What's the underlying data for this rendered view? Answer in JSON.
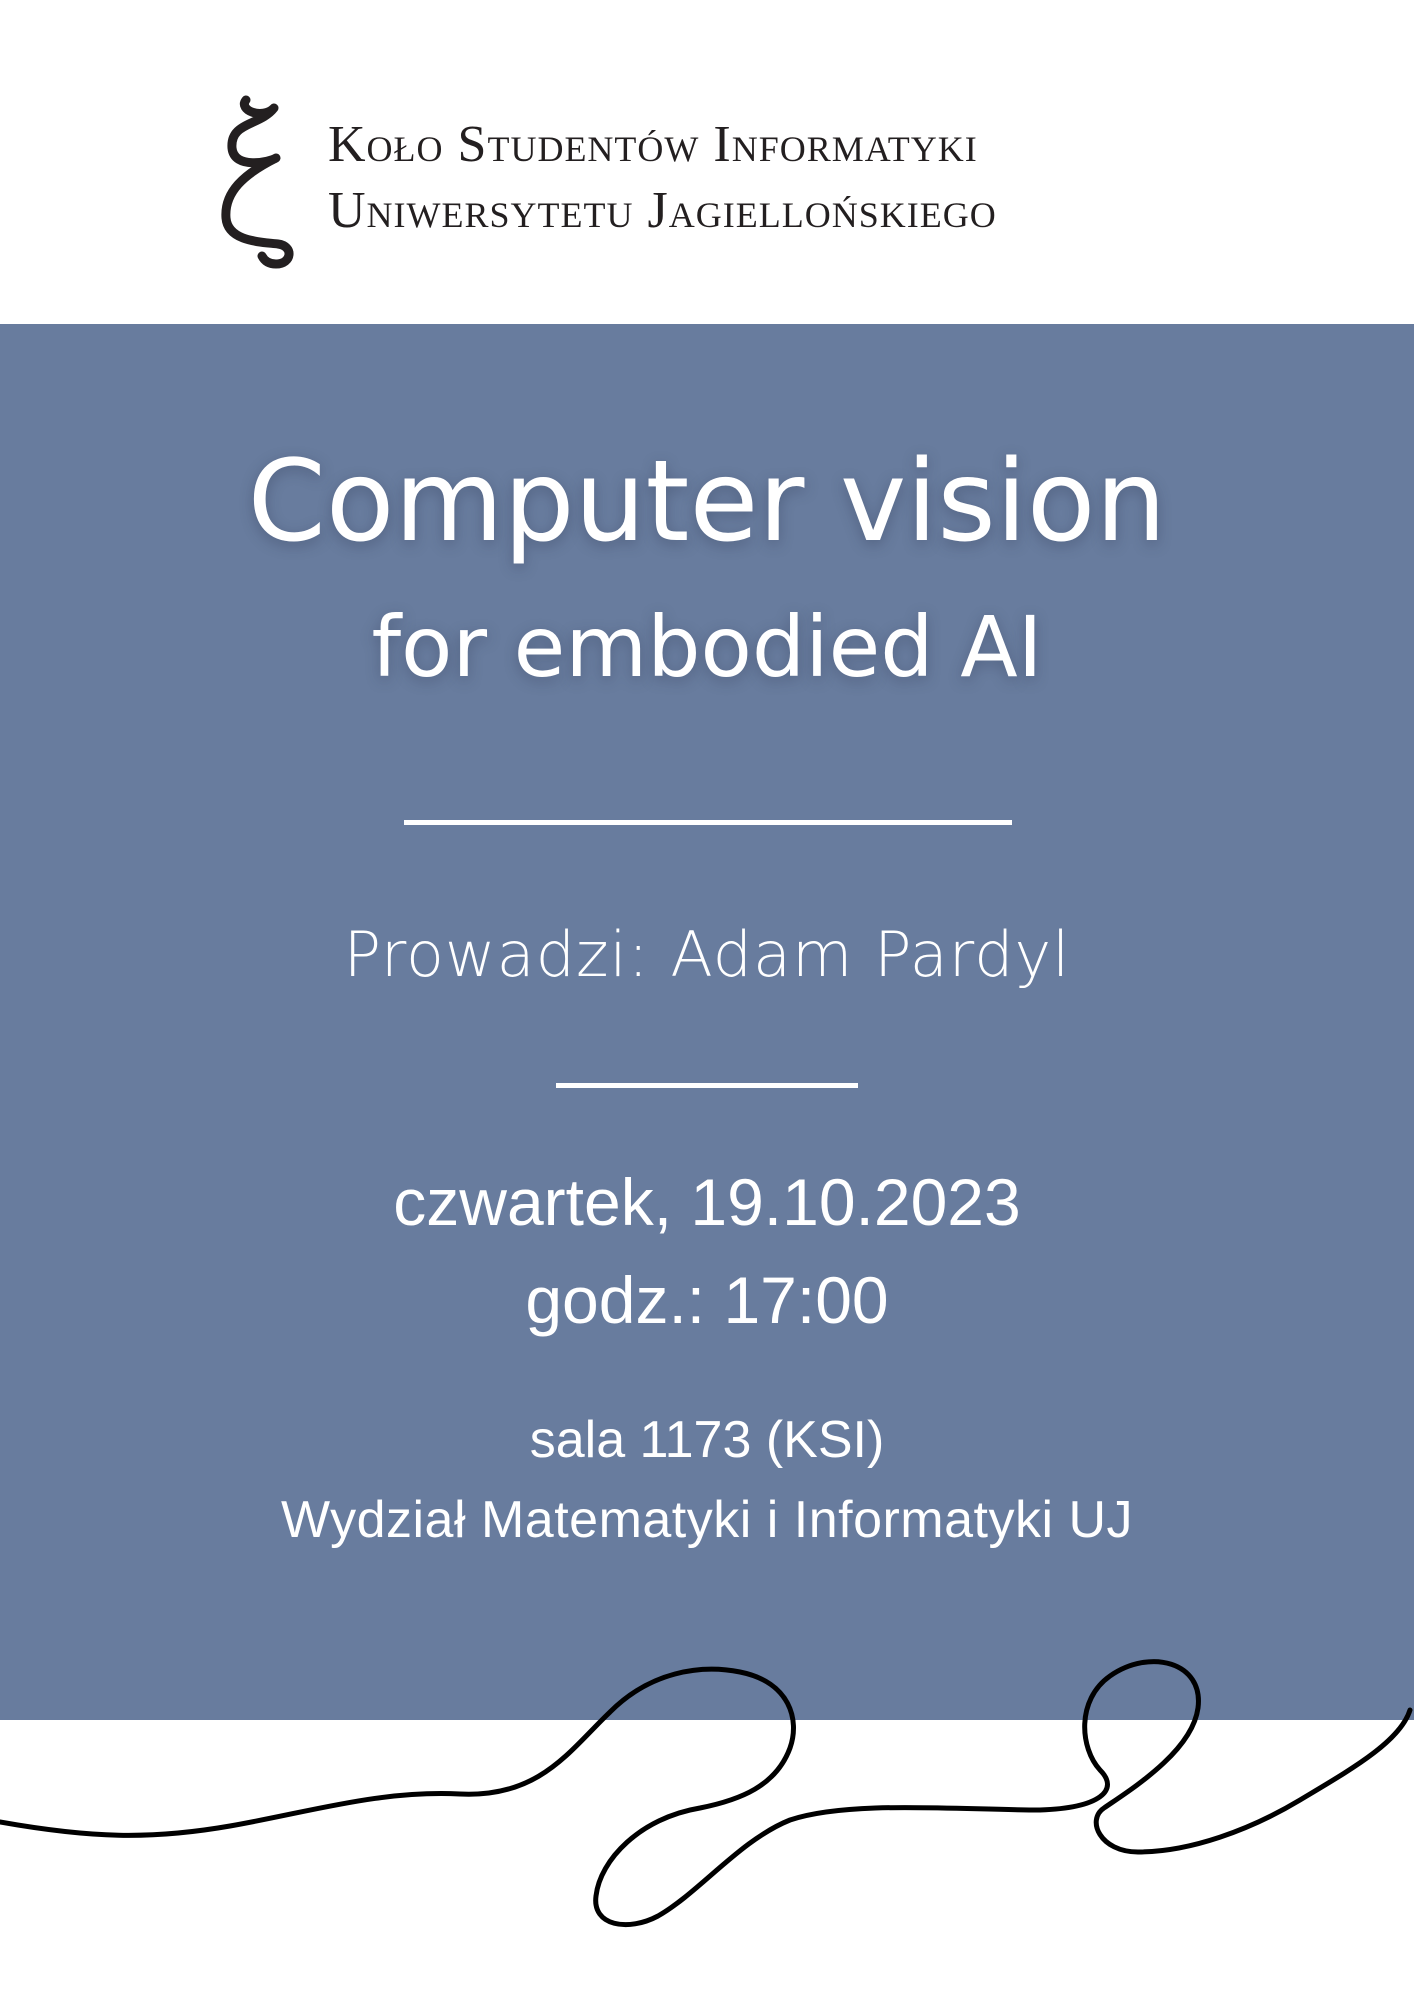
{
  "header": {
    "org_line_1": "Koło Studentów Informatyki",
    "org_line_2": "Uniwersytetu Jagiellońskiego",
    "logo_icon": "xi-letter-icon"
  },
  "event": {
    "title": "Computer vision",
    "subtitle": "for embodied AI",
    "presenter": "Prowadzi: Adam Pardyl",
    "date": "czwartek, 19.10.2023",
    "time": "godz.: 17:00",
    "room": "sala 1173 (KSI)",
    "faculty": "Wydział Matematyki i Informatyki UJ"
  },
  "colors": {
    "panel": "#687c9e",
    "text": "#ffffff",
    "header_text": "#231f20",
    "squiggle": "#000000"
  }
}
